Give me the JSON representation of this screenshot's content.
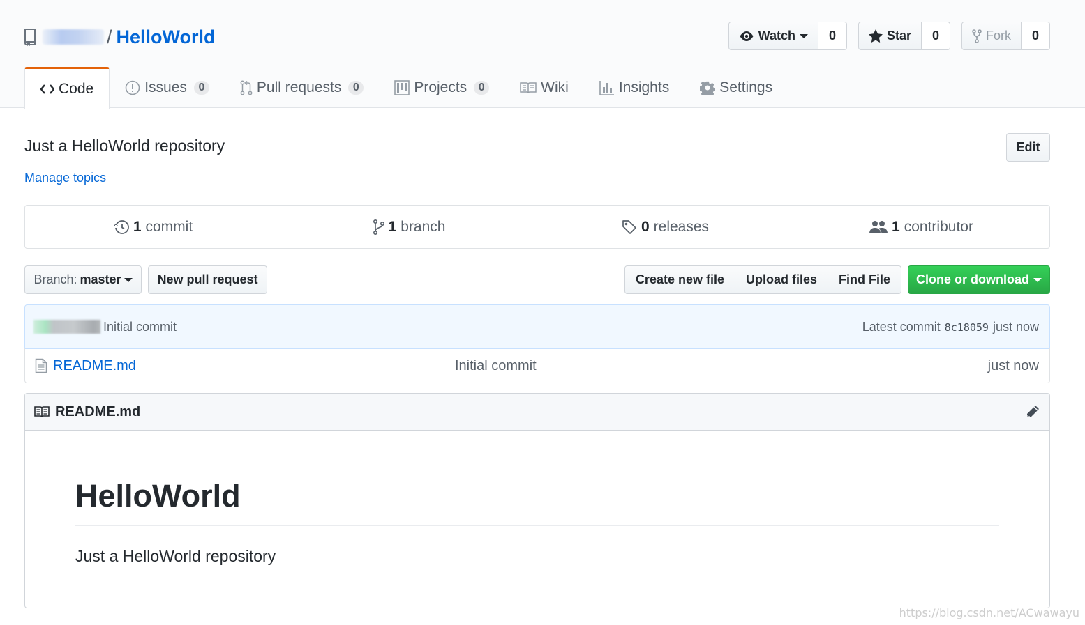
{
  "repo": {
    "name": "HelloWorld",
    "separator": "/"
  },
  "actions": {
    "watch_label": "Watch",
    "watch_count": "0",
    "star_label": "Star",
    "star_count": "0",
    "fork_label": "Fork",
    "fork_count": "0"
  },
  "nav": {
    "code": "Code",
    "issues": "Issues",
    "issues_count": "0",
    "pulls": "Pull requests",
    "pulls_count": "0",
    "projects": "Projects",
    "projects_count": "0",
    "wiki": "Wiki",
    "insights": "Insights",
    "settings": "Settings"
  },
  "description": "Just a HelloWorld repository",
  "manage_topics": "Manage topics",
  "edit_label": "Edit",
  "numbers": {
    "commits_n": "1",
    "commits_label": "commit",
    "branches_n": "1",
    "branches_label": "branch",
    "releases_n": "0",
    "releases_label": "releases",
    "contributors_n": "1",
    "contributors_label": "contributor"
  },
  "file_nav": {
    "branch_prefix": "Branch:",
    "branch_name": "master",
    "new_pr": "New pull request",
    "create_file": "Create new file",
    "upload_files": "Upload files",
    "find_file": "Find File",
    "clone": "Clone or download"
  },
  "latest_commit": {
    "message": "Initial commit",
    "prefix": "Latest commit",
    "sha": "8c18059",
    "age": "just now"
  },
  "files": [
    {
      "name": "README.md",
      "message": "Initial commit",
      "age": "just now"
    }
  ],
  "readme": {
    "filename": "README.md",
    "heading": "HelloWorld",
    "paragraph": "Just a HelloWorld repository"
  },
  "watermark": "https://blog.csdn.net/ACwawayu",
  "colors": {
    "link": "#0366d6",
    "clone_button": "#28a745",
    "selected_tab_accent": "#e36209"
  }
}
